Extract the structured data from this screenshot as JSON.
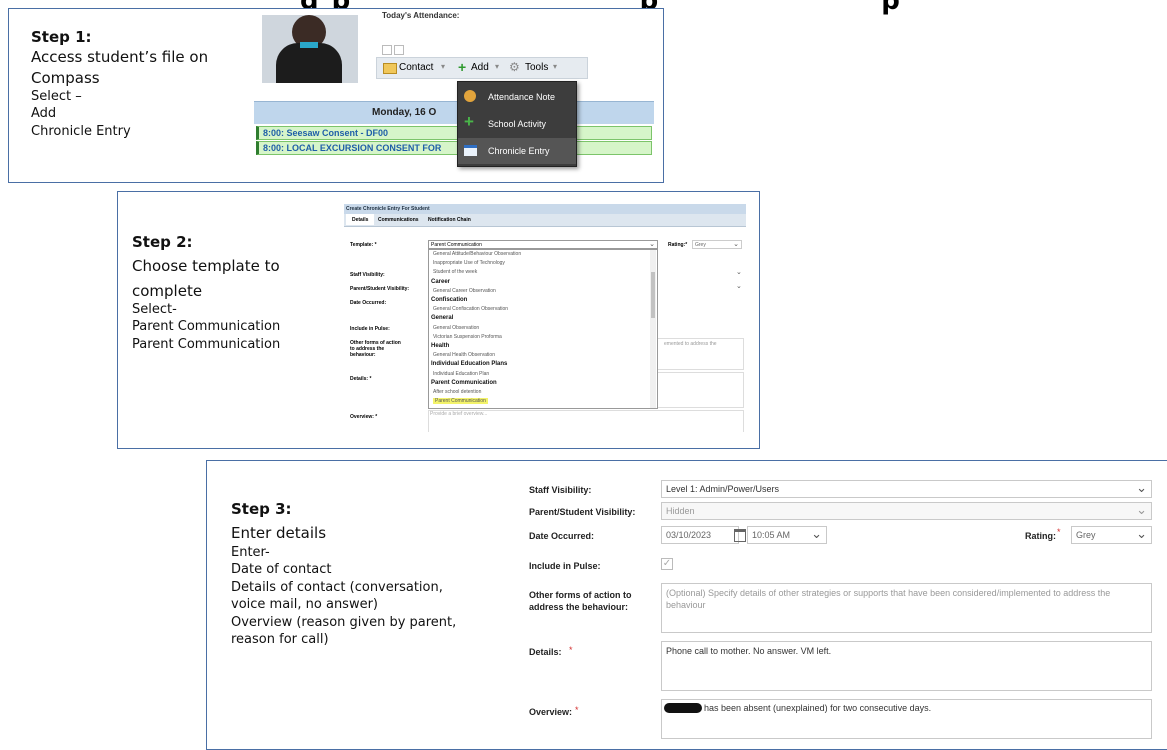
{
  "header": {
    "title_fragment": "g p                          p                    p"
  },
  "step1": {
    "title": "Step 1:",
    "lines": [
      "Access student’s file on",
      "Compass",
      "Select –",
      "Add",
      "Chronicle Entry"
    ],
    "shot": {
      "attendance_label": "Today's Attendance:",
      "toolbar": {
        "contact": "Contact",
        "add": "Add",
        "tools": "Tools"
      },
      "menu": [
        "Attendance Note",
        "School Activity",
        "Chronicle Entry"
      ],
      "day_header": "Monday, 16 O",
      "events": [
        "8:00: Seesaw Consent - DF00",
        "8:00: LOCAL EXCURSION CONSENT FOR"
      ]
    }
  },
  "step2": {
    "title": "Step 2:",
    "lines": [
      "Choose template to",
      "complete",
      "Select-",
      "Parent Communication",
      "Parent Communication"
    ],
    "shot": {
      "window_title": "Create Chronicle Entry For Student",
      "tabs": [
        "Details",
        "Communications",
        "Notification Chain"
      ],
      "labels": [
        "Template: *",
        "Staff Visibility:",
        "Parent/Student Visibility:",
        "Date Occurred:",
        "Include in Pulse:",
        "Other forms of action to address the behaviour:",
        "Details: *",
        "Overview: *"
      ],
      "template_value": "Parent Communication",
      "rating_label": "Rating:*",
      "rating_value": "Grey",
      "list": [
        {
          "t": "General Attitude/Behaviour Observation",
          "h": false
        },
        {
          "t": "Inappropriate Use of Technology",
          "h": false
        },
        {
          "t": "Student of the week",
          "h": false
        },
        {
          "t": "Career",
          "h": true
        },
        {
          "t": "General Career Observation",
          "h": false
        },
        {
          "t": "Confiscation",
          "h": true
        },
        {
          "t": "General Confiscation Observation",
          "h": false
        },
        {
          "t": "General",
          "h": true
        },
        {
          "t": "General Observation",
          "h": false
        },
        {
          "t": "Victorian Suspension Proforma",
          "h": false
        },
        {
          "t": "Health",
          "h": true
        },
        {
          "t": "General Health Observation",
          "h": false
        },
        {
          "t": "Individual Education Plans",
          "h": true
        },
        {
          "t": "Individual Education Plan",
          "h": false
        },
        {
          "t": "Parent Communication",
          "h": true
        },
        {
          "t": "After school detention",
          "h": false
        },
        {
          "t": "Parent Communication",
          "h": false
        }
      ],
      "other_text_frag": "emented to address the",
      "overview_placeholder": "Provide a brief overview..."
    }
  },
  "step3": {
    "title": "Step 3:",
    "lines": [
      "Enter details",
      "Enter-",
      "Date of contact",
      "Details of contact (conversation,",
      "voice mail, no answer)",
      "Overview (reason given by parent,",
      "reason for call)"
    ],
    "form": {
      "staff_visibility_label": "Staff Visibility:",
      "staff_visibility_value": "Level 1: Admin/Power/Users",
      "parent_visibility_label": "Parent/Student Visibility:",
      "parent_visibility_value": "Hidden",
      "date_label": "Date Occurred:",
      "date_value": "03/10/2023",
      "time_value": "10:05 AM",
      "rating_label": "Rating:",
      "rating_value": "Grey",
      "pulse_label": "Include in Pulse:",
      "other_label": "Other forms of action to address the behaviour:",
      "other_placeholder": "(Optional) Specify details of other strategies or supports that have been considered/implemented to address the behaviour",
      "details_label": "Details:",
      "details_value": "Phone call to mother. No answer. VM left.",
      "overview_label": "Overview:",
      "overview_value": "has been absent (unexplained) for two consecutive days."
    }
  },
  "colors": {
    "panel_border": "#4a6fa5",
    "required": "#d32f2f",
    "highlight": "#f3f36a",
    "event_bg": "#d6f5c9",
    "event_text": "#1f5fa8"
  }
}
